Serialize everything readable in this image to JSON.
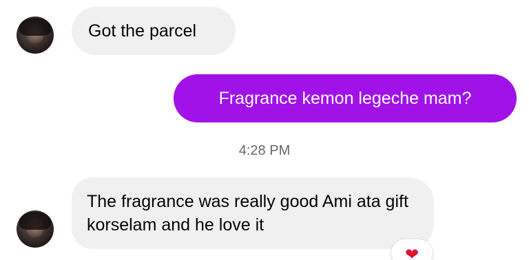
{
  "messages": [
    {
      "direction": "incoming",
      "text": "Got the parcel"
    },
    {
      "direction": "outgoing",
      "text": "Fragrance kemon legeche mam?"
    },
    {
      "direction": "incoming",
      "text": "The fragrance was really good Ami ata gift korselam and he love it"
    }
  ],
  "timestamp": "4:28 PM",
  "reaction": {
    "icon": "heart-icon",
    "glyph": "❤",
    "color": "#e0112f"
  },
  "colors": {
    "outgoing_bubble": "#a012e8",
    "incoming_bubble": "#f0f0f0",
    "timestamp_text": "#65676b"
  }
}
